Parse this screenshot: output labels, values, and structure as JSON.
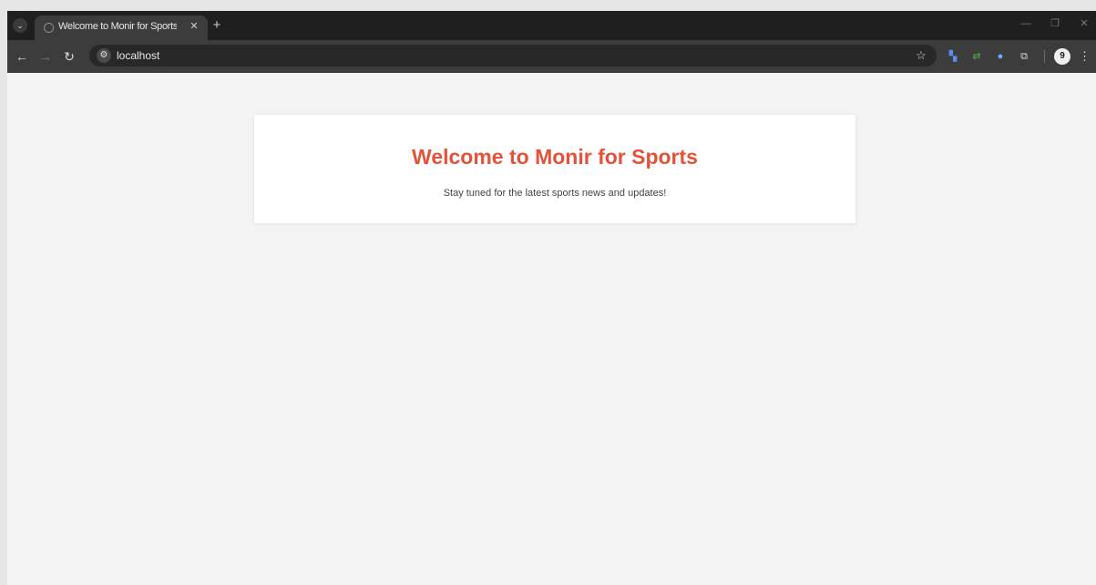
{
  "browser": {
    "tab": {
      "title": "Welcome to Monir for Sports",
      "close_glyph": "✕"
    },
    "new_tab_glyph": "+",
    "search_tabs_glyph": "⌄",
    "window_controls": [
      "—",
      "❐",
      "✕"
    ],
    "nav": {
      "back_glyph": "←",
      "forward_glyph": "→",
      "reload_glyph": "↻"
    },
    "address_bar": {
      "url": "localhost",
      "site_info_glyph": "⚙",
      "bookmark_glyph": "☆"
    },
    "extensions": [
      {
        "name": "translate-extension-icon",
        "glyph": "▚",
        "color": "#5b8def"
      },
      {
        "name": "sync-extension-icon",
        "glyph": "⇄",
        "color": "#4caf50"
      },
      {
        "name": "blue-dot-extension-icon",
        "glyph": "●",
        "color": "#6fa8ff"
      },
      {
        "name": "puzzle-extensions-icon",
        "glyph": "⧉",
        "color": "#dcdcdc"
      }
    ],
    "profile_initial": "9",
    "menu_glyph": "⋮"
  },
  "page": {
    "title": "Welcome to Monir for Sports",
    "subtitle": "Stay tuned for the latest sports news and updates!"
  },
  "colors": {
    "accent": "#e2533a",
    "page_bg": "#f3f3f3",
    "card_bg": "#ffffff"
  }
}
